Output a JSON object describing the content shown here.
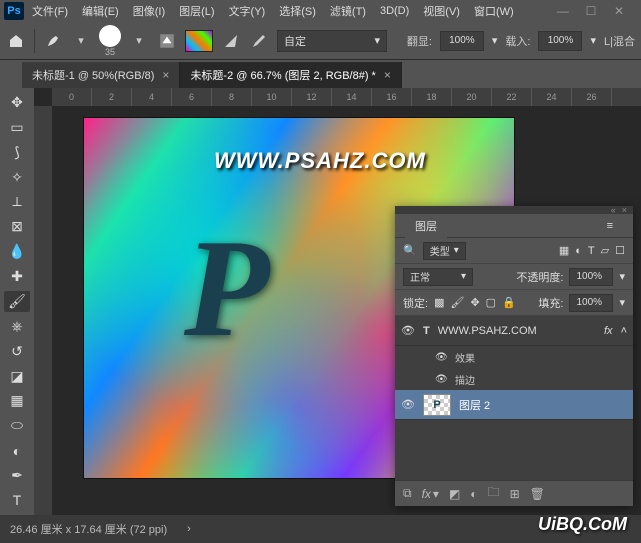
{
  "menu": {
    "items": [
      "文件(F)",
      "编辑(E)",
      "图像(I)",
      "图层(L)",
      "文字(Y)",
      "选择(S)",
      "滤镜(T)",
      "3D(D)",
      "视图(V)",
      "窗口(W)"
    ]
  },
  "options": {
    "brush_size": "35",
    "mode_label": "自定",
    "opacity_label": "翻显:",
    "opacity_value": "100%",
    "flow_label": "载入:",
    "flow_value": "100%",
    "smooth_label": "L|混合"
  },
  "tabs": [
    {
      "label": "未标题-1 @ 50%(RGB/8)",
      "active": false
    },
    {
      "label": "未标题-2 @ 66.7% (图层 2, RGB/8#) *",
      "active": true
    }
  ],
  "ruler": [
    "0",
    "2",
    "4",
    "6",
    "8",
    "10",
    "12",
    "14",
    "16",
    "18",
    "20",
    "22",
    "24",
    "26"
  ],
  "canvas": {
    "watermark": "WWW.PSAHZ.COM",
    "letter": "P"
  },
  "layers": {
    "title": "图层",
    "filter_label": "类型",
    "blend_mode": "正常",
    "opacity_label": "不透明度:",
    "opacity_value": "100%",
    "lock_label": "锁定:",
    "fill_label": "填充:",
    "fill_value": "100%",
    "items": [
      {
        "name": "WWW.PSAHZ.COM",
        "type": "text",
        "fx": "fx"
      },
      {
        "name": "效果",
        "type": "fx-group"
      },
      {
        "name": "描边",
        "type": "fx-sub"
      },
      {
        "name": "图层 2",
        "type": "raster",
        "selected": true
      }
    ]
  },
  "status": {
    "info": "26.46 厘米 x 17.64 厘米 (72 ppi)"
  },
  "credit": "UiBQ.CoM",
  "icons": {
    "search": "🔍",
    "link": "⧉"
  }
}
